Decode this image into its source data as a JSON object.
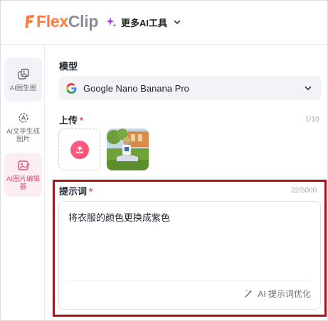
{
  "header": {
    "logo_flex": "Flex",
    "logo_clip": "Clip",
    "tools_label": "更多AI工具"
  },
  "sidebar": {
    "items": [
      {
        "label": "AI图生图",
        "icon": "image-to-image-icon"
      },
      {
        "label": "AI文字生成图片",
        "icon": "text-to-image-icon"
      },
      {
        "label": "AI图片编辑器",
        "icon": "image-editor-icon",
        "active": true
      }
    ]
  },
  "model": {
    "label": "模型",
    "selected": "Google Nano Banana Pro"
  },
  "upload": {
    "label": "上传",
    "required_mark": "*",
    "counter": "1/10"
  },
  "prompt": {
    "label": "提示词",
    "required_mark": "*",
    "counter": "22/5000",
    "text": "将衣服的颜色更换成紫色",
    "optimize_label": "AI 提示词优化"
  },
  "colors": {
    "accent": "#e14d7a",
    "highlight_border": "#a4161a",
    "logo_orange": "#ff7a3c"
  }
}
